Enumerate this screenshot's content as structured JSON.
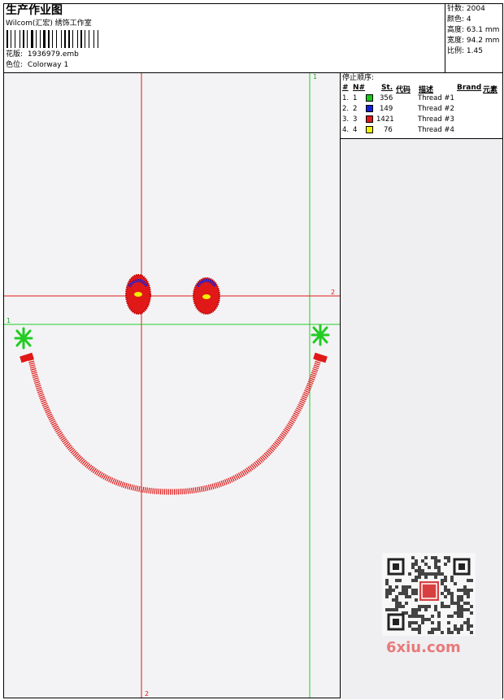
{
  "header": {
    "title": "生产作业图",
    "company": "Wilcom(汇宏) 绣饰工作室",
    "design_label": "花版:",
    "design_value": "1936979.emb",
    "colorway_label": "色位:",
    "colorway_value": "Colorway 1"
  },
  "stats": {
    "stitches_label": "针数:",
    "stitches_value": "2004",
    "colors_label": "颜色:",
    "colors_value": "4",
    "height_label": "高度:",
    "height_value": "63.1 mm",
    "width_label": "宽度:",
    "width_value": "94.2 mm",
    "scale_label": "比例:",
    "scale_value": "1.45"
  },
  "sequence": {
    "title": "停止顺序:",
    "headers": {
      "index": "#",
      "needle": "N#",
      "st": "St.",
      "code": "代码",
      "desc": "描述",
      "brand": "Brand",
      "element": "元素"
    },
    "rows": [
      {
        "index": "1.",
        "needle": "1",
        "color": "#19c619",
        "stitches": "356",
        "desc": "Thread #1"
      },
      {
        "index": "2.",
        "needle": "2",
        "color": "#1020d8",
        "stitches": "149",
        "desc": "Thread #2"
      },
      {
        "index": "3.",
        "needle": "3",
        "color": "#e01818",
        "stitches": "1421",
        "desc": "Thread #3"
      },
      {
        "index": "4.",
        "needle": "4",
        "color": "#f0f000",
        "stitches": "76",
        "desc": "Thread #4"
      }
    ]
  },
  "guides": {
    "v_green_label": "1",
    "h_red_label": "2",
    "h_green_label": "1",
    "v_red_label": "2"
  },
  "colors": {
    "guide_red": "#e01818",
    "guide_green": "#22cc22",
    "canvas_bg": "#f3f3f5"
  },
  "watermark": {
    "text": "6xiu.com"
  }
}
